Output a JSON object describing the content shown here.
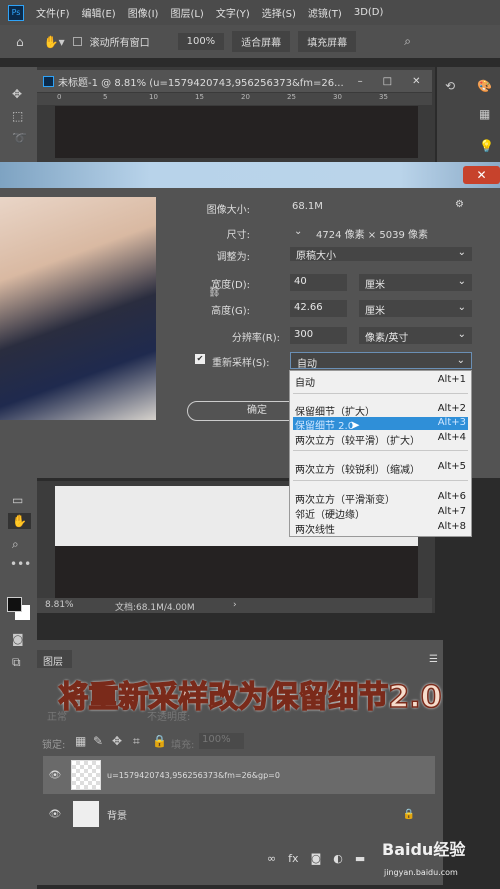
{
  "menubar": {
    "logo": "Ps",
    "items": [
      "文件(F)",
      "编辑(E)",
      "图像(I)",
      "图层(L)",
      "文字(Y)",
      "选择(S)",
      "滤镜(T)",
      "3D(D)"
    ]
  },
  "options": {
    "scroll_all": "滚动所有窗口",
    "zoom100": "100%",
    "fit_screen": "适合屏幕",
    "fill_screen": "填充屏幕"
  },
  "document": {
    "title": "未标题-1 @ 8.81% (u=1579420743,956256373&fm=26...",
    "ruler": [
      "0",
      "5",
      "10",
      "15",
      "20",
      "25",
      "30",
      "35"
    ],
    "zoom": "8.81%",
    "doc_info": "文档:68.1M/4.00M"
  },
  "dialog": {
    "image_size_label": "图像大小:",
    "image_size": "68.1M",
    "dimensions_label": "尺寸:",
    "dimensions": "4724 像素 × 5039 像素",
    "fit_to_label": "调整为:",
    "fit_to": "原稿大小",
    "width_label": "宽度(D):",
    "width": "40",
    "width_unit": "厘米",
    "height_label": "高度(G):",
    "height": "42.66",
    "height_unit": "厘米",
    "resolution_label": "分辨率(R):",
    "resolution": "300",
    "resolution_unit": "像素/英寸",
    "resample_label": "重新采样(S):",
    "resample_checked": true,
    "resample": "自动",
    "ok": "确定"
  },
  "resample_menu": [
    {
      "label": "自动",
      "shortcut": "Alt+1"
    },
    {
      "label": "保留细节（扩大）",
      "shortcut": "Alt+2"
    },
    {
      "label": "保留细节 2.0",
      "shortcut": "Alt+3",
      "highlighted": true
    },
    {
      "label": "两次立方（较平滑）（扩大）",
      "shortcut": "Alt+4"
    },
    {
      "label": "两次立方（较锐利）（缩减）",
      "shortcut": "Alt+5"
    },
    {
      "label": "两次立方（平滑渐变）",
      "shortcut": "Alt+6"
    },
    {
      "label": "邻近（硬边缘）",
      "shortcut": "Alt+7"
    },
    {
      "label": "两次线性",
      "shortcut": "Alt+8"
    }
  ],
  "layers": {
    "tab": "图层",
    "blend": "正常",
    "opacity_label": "不透明度:",
    "lock_label": "锁定:",
    "fill_label": "填充:",
    "fill": "100%",
    "items": [
      {
        "name": "u=1579420743,956256373&fm=26&gp=0",
        "selected": true
      },
      {
        "name": "背景",
        "locked": true
      }
    ]
  },
  "caption": "将重新采样改为保留细节2.0",
  "watermark": {
    "brand": "Baidu经验",
    "url": "jingyan.baidu.com"
  },
  "colors": {
    "highlight": "#2f8fd8",
    "dialog_title": "#b8d3ea",
    "close": "#c7422c"
  }
}
